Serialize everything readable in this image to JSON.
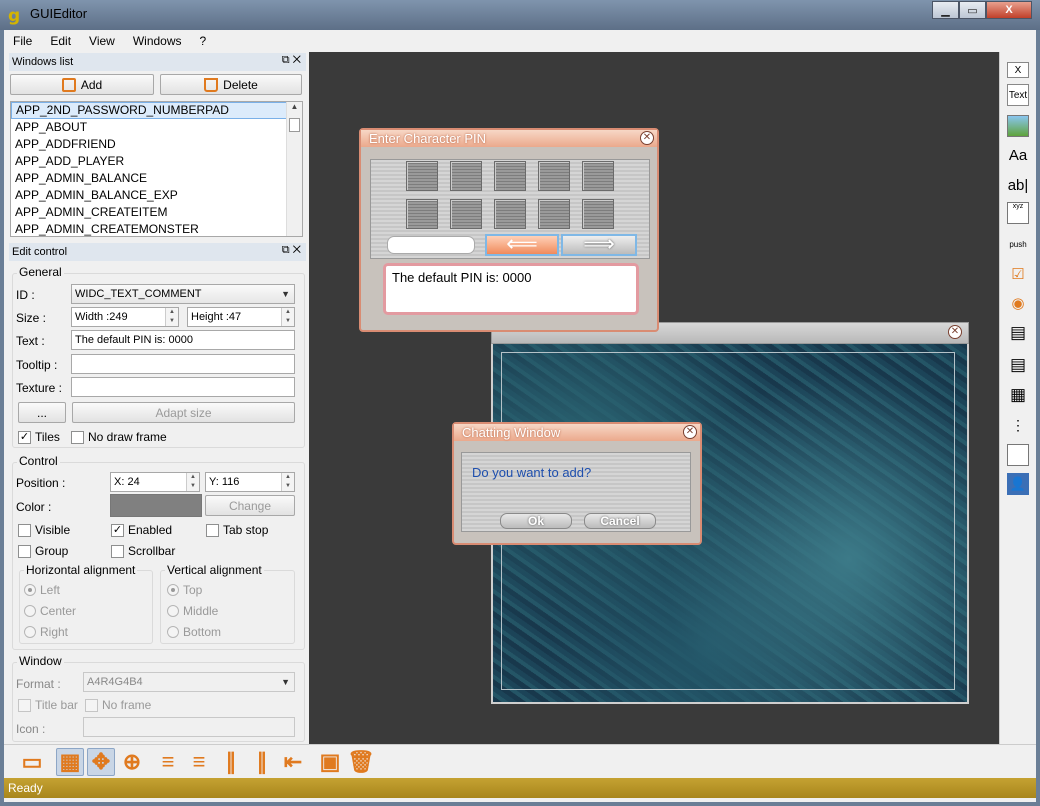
{
  "app": {
    "title": "GUIEditor",
    "icon": "g"
  },
  "window_controls": {
    "minimize": "▁",
    "maximize": "▭",
    "close": "X"
  },
  "menu": [
    "File",
    "Edit",
    "View",
    "Windows",
    "?"
  ],
  "windows_list": {
    "title": "Windows list",
    "add_label": "Add",
    "delete_label": "Delete",
    "items": [
      "APP_2ND_PASSWORD_NUMBERPAD",
      "APP_ABOUT",
      "APP_ADDFRIEND",
      "APP_ADD_PLAYER",
      "APP_ADMIN_BALANCE",
      "APP_ADMIN_BALANCE_EXP",
      "APP_ADMIN_CREATEITEM",
      "APP_ADMIN_CREATEMONSTER"
    ]
  },
  "edit_control": {
    "title": "Edit control",
    "general": {
      "label": "General",
      "id_label": "ID :",
      "id_value": "WIDC_TEXT_COMMENT",
      "size_label": "Size :",
      "width": "Width :249",
      "height": "Height :47",
      "text_label": "Text :",
      "text_value": "The default PIN is: 0000",
      "tooltip_label": "Tooltip :",
      "texture_label": "Texture :",
      "browse_label": "...",
      "adapt_label": "Adapt size",
      "tiles_label": "Tiles",
      "nodraw_label": "No draw frame"
    },
    "control": {
      "label": "Control",
      "position_label": "Position :",
      "x": "X: 24",
      "y": "Y: 116",
      "color_label": "Color :",
      "color_value": "#808080",
      "change_label": "Change",
      "visible_label": "Visible",
      "enabled_label": "Enabled",
      "tabstop_label": "Tab stop",
      "group_label": "Group",
      "scrollbar_label": "Scrollbar",
      "halign_label": "Horizontal alignment",
      "h_left": "Left",
      "h_center": "Center",
      "h_right": "Right",
      "valign_label": "Vertical alignment",
      "v_top": "Top",
      "v_middle": "Middle",
      "v_bottom": "Bottom"
    },
    "window": {
      "label": "Window",
      "format_label": "Format :",
      "format_value": "A4R4G4B4",
      "titlebar_label": "Title bar",
      "noframe_label": "No frame",
      "icon_label": "Icon :"
    }
  },
  "canvas": {
    "pin_window_title": "Enter Character PIN",
    "pin_text": "The default PIN is: 0000",
    "chat_window_title": "Chatting Window",
    "chat_question": "Do you want to add?",
    "ok_label": "Ok",
    "cancel_label": "Cancel"
  },
  "toolbox": {
    "close_label": "X",
    "text_label": "Text",
    "font_label": "Aa",
    "edit_label": "ab|",
    "xyz_label": "xyz",
    "push_label": "push"
  },
  "status": "Ready"
}
